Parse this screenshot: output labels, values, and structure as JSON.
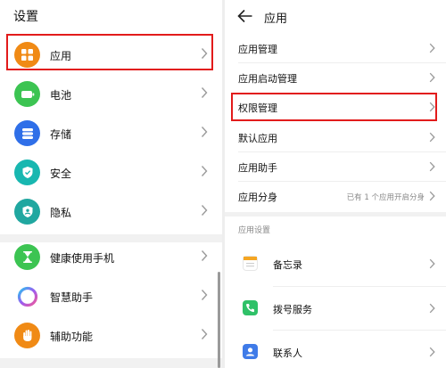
{
  "left": {
    "title": "设置",
    "items": [
      {
        "label": "应用",
        "icon": "apps-icon",
        "color": "#f08a15"
      },
      {
        "label": "电池",
        "icon": "battery-icon",
        "color": "#3cc452"
      },
      {
        "label": "存储",
        "icon": "storage-icon",
        "color": "#2f6fe8"
      },
      {
        "label": "安全",
        "icon": "shield-icon",
        "color": "#18b7b0"
      },
      {
        "label": "隐私",
        "icon": "privacy-icon",
        "color": "#20a7a0"
      },
      {
        "label": "健康使用手机",
        "icon": "hourglass-icon",
        "color": "#3cc452"
      },
      {
        "label": "智慧助手",
        "icon": "assistant-icon",
        "color": "#9c5cf0"
      },
      {
        "label": "辅助功能",
        "icon": "hand-icon",
        "color": "#f08a15"
      }
    ]
  },
  "right": {
    "title": "应用",
    "items": [
      {
        "label": "应用管理",
        "value": ""
      },
      {
        "label": "应用启动管理",
        "value": ""
      },
      {
        "label": "权限管理",
        "value": ""
      },
      {
        "label": "默认应用",
        "value": ""
      },
      {
        "label": "应用助手",
        "value": ""
      },
      {
        "label": "应用分身",
        "value": "已有 1 个应用开启分身"
      }
    ],
    "section_label": "应用设置",
    "apps": [
      {
        "label": "备忘录",
        "icon": "notepad-icon",
        "color": "#f5a623"
      },
      {
        "label": "拨号服务",
        "icon": "phone-icon",
        "color": "#2fc168"
      },
      {
        "label": "联系人",
        "icon": "contacts-icon",
        "color": "#3f7be8"
      }
    ]
  },
  "highlight_color": "#e21b1b"
}
